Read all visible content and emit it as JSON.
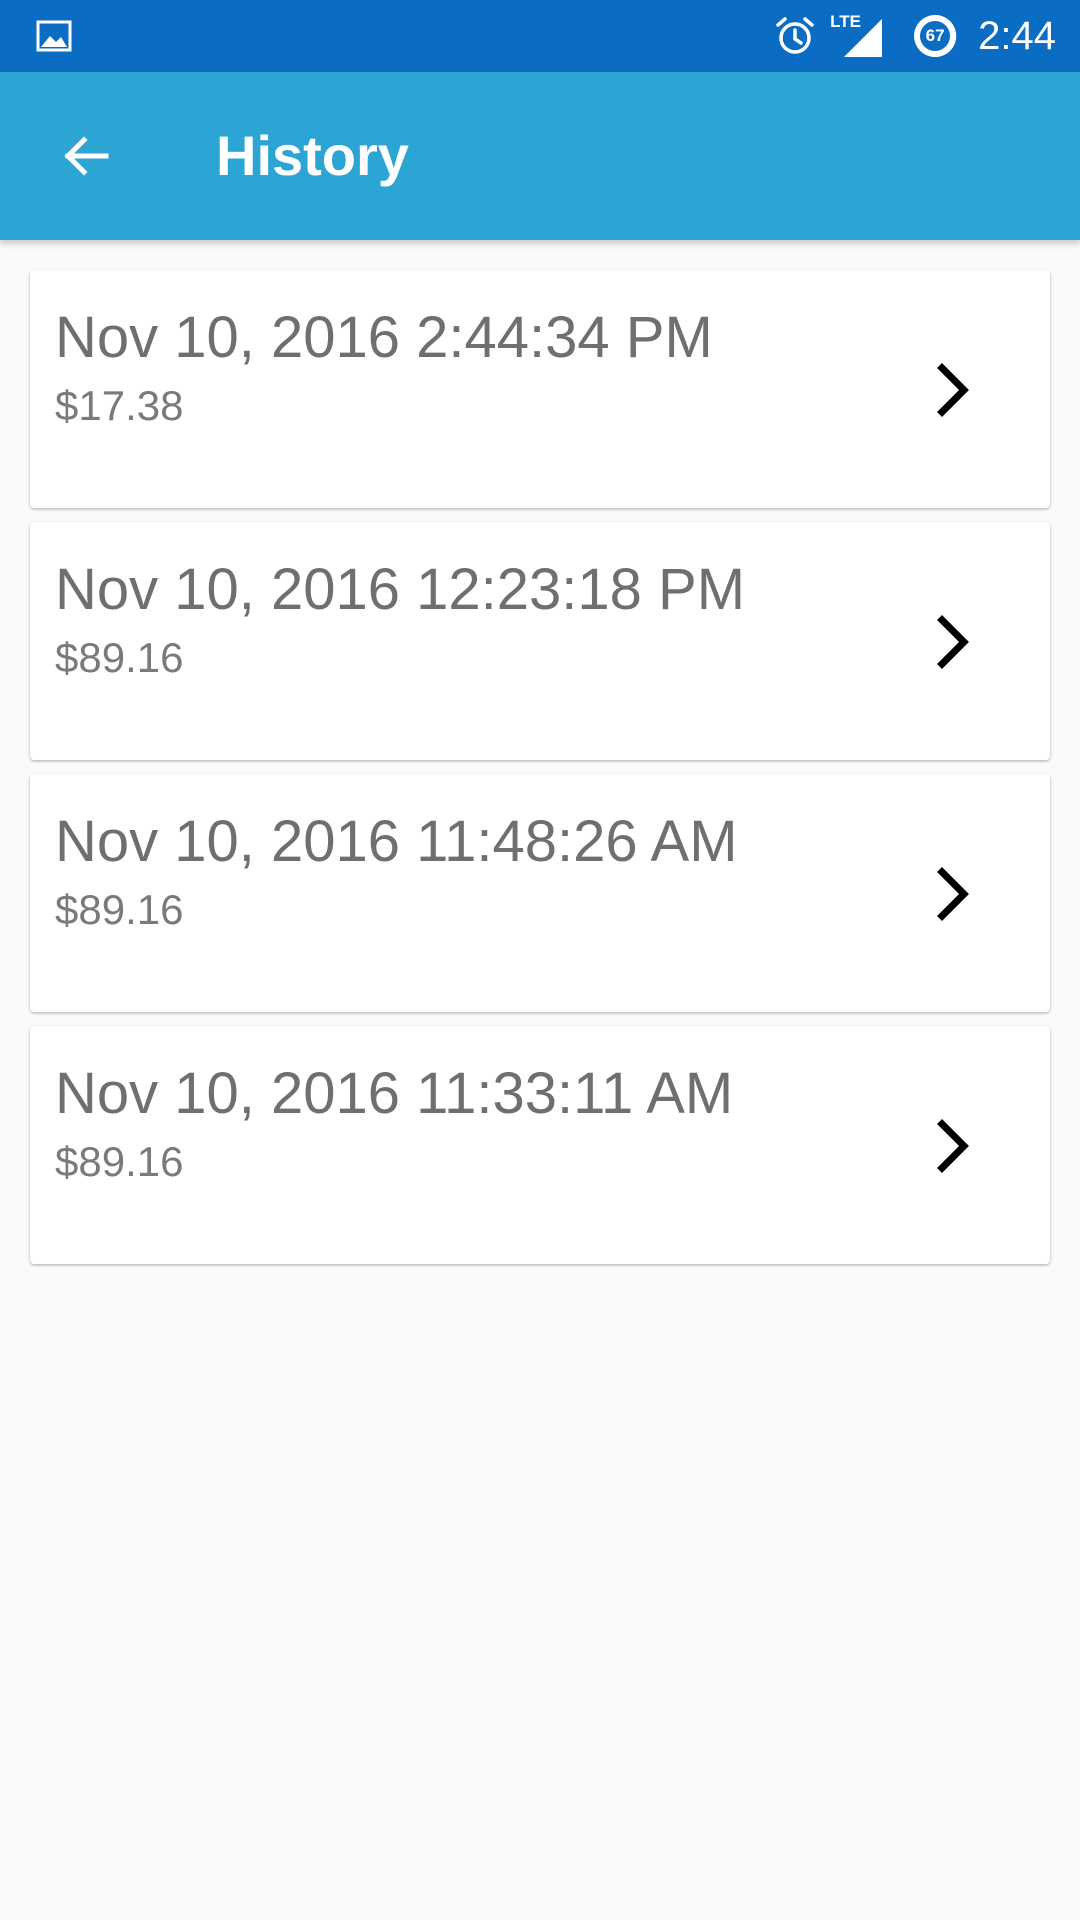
{
  "status_bar": {
    "time": "2:44",
    "battery_level": "67",
    "network_label": "LTE",
    "icons": [
      "image-icon",
      "alarm-icon",
      "lte-signal-icon",
      "battery-icon"
    ]
  },
  "app_bar": {
    "title": "History",
    "back_icon": "arrow-back-icon",
    "color": "#2da5d4"
  },
  "history": {
    "items": [
      {
        "date": "Nov 10, 2016 2:44:34 PM",
        "amount": "$17.38"
      },
      {
        "date": "Nov 10, 2016 12:23:18 PM",
        "amount": "$89.16"
      },
      {
        "date": "Nov 10, 2016 11:48:26 AM",
        "amount": "$89.16"
      },
      {
        "date": "Nov 10, 2016 11:33:11 AM",
        "amount": "$89.16"
      }
    ],
    "chevron_icon": "chevron-right-icon"
  }
}
